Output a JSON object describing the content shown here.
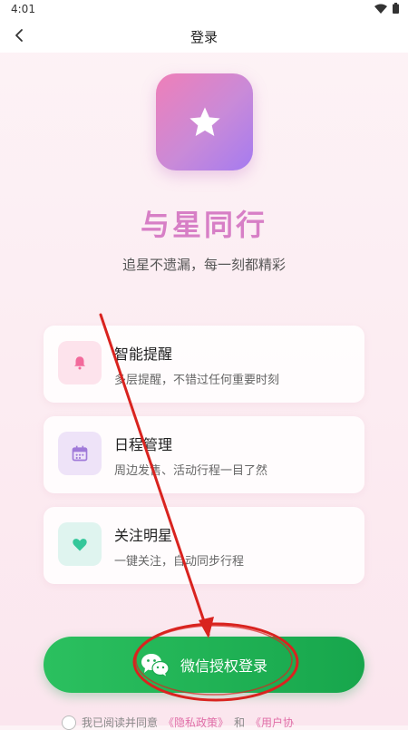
{
  "status_bar": {
    "time": "4:01",
    "wifi_icon": "wifi-icon",
    "battery_icon": "battery-icon"
  },
  "nav": {
    "title": "登录",
    "back_icon": "chevron-left-icon"
  },
  "app": {
    "logo_icon": "star-icon",
    "name": "与星同行",
    "slogan": "追星不遗漏，每一刻都精彩"
  },
  "features": [
    {
      "icon": "bell-icon",
      "title": "智能提醒",
      "desc": "多层提醒，不错过任何重要时刻",
      "icon_color": "#f26a9b",
      "icon_bg": "#fde3ec"
    },
    {
      "icon": "calendar-icon",
      "title": "日程管理",
      "desc": "周边发售、活动行程一目了然",
      "icon_color": "#a07ad9",
      "icon_bg": "#eee3f8"
    },
    {
      "icon": "heart-icon",
      "title": "关注明星",
      "desc": "一键关注，自动同步行程",
      "icon_color": "#34c79a",
      "icon_bg": "#dff4ef"
    }
  ],
  "login": {
    "icon": "wechat-icon",
    "label": "微信授权登录",
    "color": "#1faa52"
  },
  "agreement": {
    "prefix": "我已阅读并同意",
    "privacy": "《隐私政策》",
    "and": "和",
    "terms": "《用户协"
  },
  "colors": {
    "accent": "#d77fc6",
    "annotation": "#d9231f"
  }
}
